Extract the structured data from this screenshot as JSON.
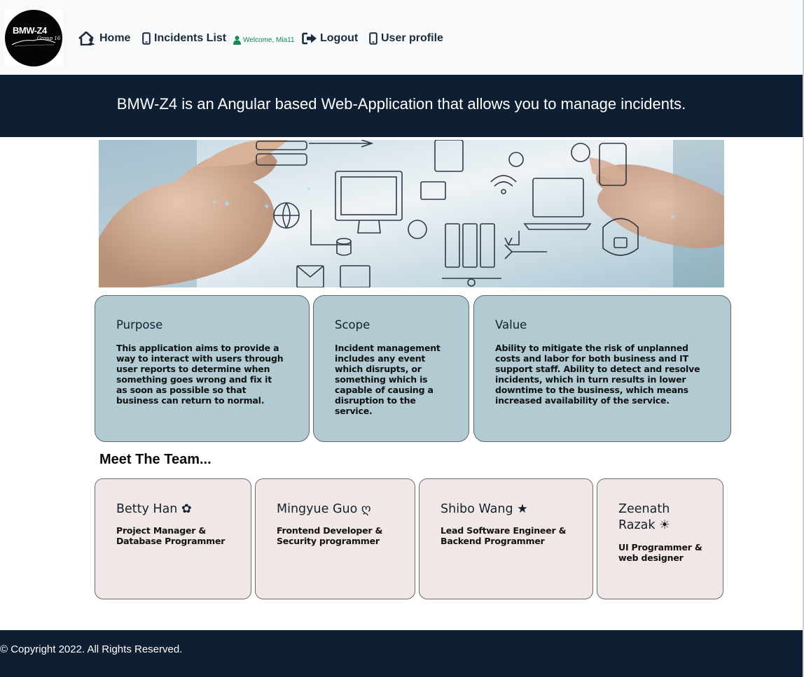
{
  "navbar": {
    "logo_title": "BMW-Z4",
    "logo_subtitle": "Group 16",
    "home_label": "Home",
    "home_icon": "house-user-icon",
    "incidents_label": "Incidents List",
    "incidents_icon": "mobile-phone-icon",
    "welcome_text": "Welcome, Mia11",
    "welcome_icon": "user-icon",
    "logout_label": "Logout",
    "logout_icon": "sign-out-icon",
    "profile_label": "User profile",
    "profile_icon": "mobile-phone-icon"
  },
  "banner": {
    "text": "BMW-Z4 is an Angular based Web-Application that allows you to manage incidents."
  },
  "info_cards": [
    {
      "title": "Purpose",
      "body": "This application aims to provide a way to interact with users through user reports to determine when something goes wrong and fix it as soon as possible so that business can return to normal."
    },
    {
      "title": "Scope",
      "body": "Incident management includes any event which disrupts, or something which is capable of causing a disruption to the service."
    },
    {
      "title": "Value",
      "body": "Ability to mitigate the risk of unplanned costs and labor for both business and IT support staff. Ability to detect and resolve incidents, which in turn results in lower downtime to the business, which means increased availability of the service."
    }
  ],
  "team": {
    "heading": "Meet The Team...",
    "members": [
      {
        "name": "Betty Han ✿",
        "role": "Project Manager & Database Programmer"
      },
      {
        "name": "Mingyue Guo ღ",
        "role": "Frontend Developer & Security programmer"
      },
      {
        "name": "Shibo Wang ★",
        "role": "Lead Software Engineer & Backend Programmer"
      },
      {
        "name": "Zeenath Razak ☀",
        "role": "UI Programmer & web designer"
      }
    ]
  },
  "footer": {
    "text": "© Copyright 2022. All Rights Reserved."
  },
  "colors": {
    "navbar_bg": "#f8f9fa",
    "dark_navy": "#0f1f33",
    "info_card_bg": "#b2cbd3",
    "team_card_bg": "#f2e7e7",
    "welcome_green": "#198754"
  }
}
